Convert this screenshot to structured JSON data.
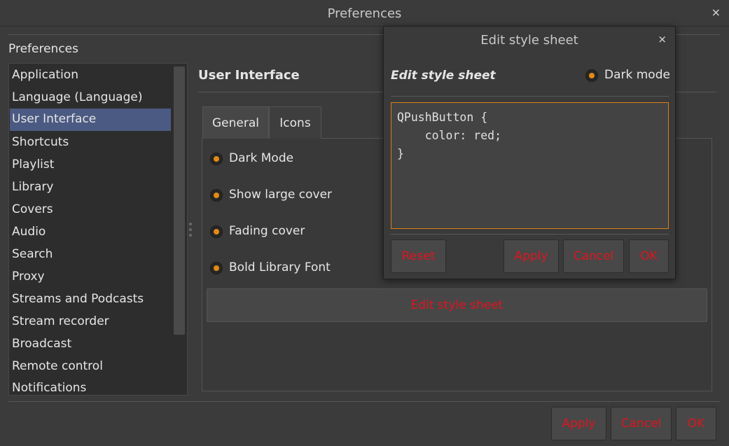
{
  "window": {
    "title": "Preferences",
    "close_glyph": "×"
  },
  "sidebar": {
    "section_label": "Preferences",
    "items": [
      {
        "label": "Application"
      },
      {
        "label": "Language (Language)"
      },
      {
        "label": "User Interface",
        "selected": true
      },
      {
        "label": "Shortcuts"
      },
      {
        "label": "Playlist"
      },
      {
        "label": "Library"
      },
      {
        "label": "Covers"
      },
      {
        "label": "Audio"
      },
      {
        "label": "Search"
      },
      {
        "label": "Proxy"
      },
      {
        "label": "Streams and Podcasts"
      },
      {
        "label": "Stream recorder"
      },
      {
        "label": "Broadcast"
      },
      {
        "label": "Remote control"
      },
      {
        "label": "Notifications"
      }
    ]
  },
  "page": {
    "heading": "User Interface",
    "tabs": [
      {
        "label": "General",
        "active": true
      },
      {
        "label": "Icons",
        "active": false
      }
    ],
    "options": [
      {
        "label": "Dark Mode",
        "checked": true
      },
      {
        "label": "Show large cover",
        "checked": true
      },
      {
        "label": "Fading cover",
        "checked": true
      },
      {
        "label": "Bold Library Font",
        "checked": true
      }
    ],
    "edit_button_label": "Edit style sheet"
  },
  "footer": {
    "apply": "Apply",
    "cancel": "Cancel",
    "ok": "OK"
  },
  "dialog": {
    "title": "Edit style sheet",
    "close_glyph": "×",
    "heading": "Edit style sheet",
    "dark_mode_label": "Dark mode",
    "dark_mode_checked": true,
    "stylesheet_text": "QPushButton {\n    color: red;\n}",
    "buttons": {
      "reset": "Reset",
      "apply": "Apply",
      "cancel": "Cancel",
      "ok": "OK"
    }
  },
  "colors": {
    "background": "#3b3b3b",
    "selection": "#4b5a82",
    "accent_orange": "#e58a0f",
    "button_text_red": "#e0141e"
  },
  "icons": {
    "close": "close-icon",
    "radio": "radio-button-icon",
    "splitter": "splitter-handle-icon"
  }
}
